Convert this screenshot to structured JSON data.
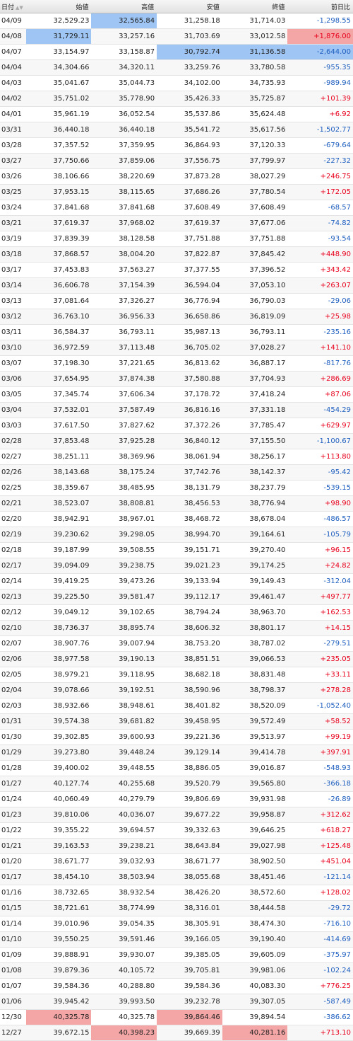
{
  "headers": {
    "date": "日付",
    "open": "始値",
    "high": "高値",
    "low": "安値",
    "close": "終値",
    "change": "前日比"
  },
  "sort_icons": {
    "up": "▲",
    "down": "▼"
  },
  "colors": {
    "positive": "#e8001c",
    "negative": "#1f5fc0",
    "highlight_blue": "#9ec5f3",
    "highlight_red": "#f4a6a6"
  },
  "rows": [
    {
      "date": "04/09",
      "open": "32,529.23",
      "high": "32,565.84",
      "low": "31,258.18",
      "close": "31,714.03",
      "change": "-1,298.55"
    },
    {
      "date": "04/08",
      "open": "31,729.11",
      "high": "33,257.16",
      "low": "31,703.69",
      "close": "33,012.58",
      "change": "+1,876.00"
    },
    {
      "date": "04/07",
      "open": "33,154.97",
      "high": "33,158.87",
      "low": "30,792.74",
      "close": "31,136.58",
      "change": "-2,644.00"
    },
    {
      "date": "04/04",
      "open": "34,304.66",
      "high": "34,320.11",
      "low": "33,259.76",
      "close": "33,780.58",
      "change": "-955.35"
    },
    {
      "date": "04/03",
      "open": "35,041.67",
      "high": "35,044.73",
      "low": "34,102.00",
      "close": "34,735.93",
      "change": "-989.94"
    },
    {
      "date": "04/02",
      "open": "35,751.02",
      "high": "35,778.90",
      "low": "35,426.33",
      "close": "35,725.87",
      "change": "+101.39"
    },
    {
      "date": "04/01",
      "open": "35,961.19",
      "high": "36,052.54",
      "low": "35,537.86",
      "close": "35,624.48",
      "change": "+6.92"
    },
    {
      "date": "03/31",
      "open": "36,440.18",
      "high": "36,440.18",
      "low": "35,541.72",
      "close": "35,617.56",
      "change": "-1,502.77"
    },
    {
      "date": "03/28",
      "open": "37,357.52",
      "high": "37,359.95",
      "low": "36,864.93",
      "close": "37,120.33",
      "change": "-679.64"
    },
    {
      "date": "03/27",
      "open": "37,750.66",
      "high": "37,859.06",
      "low": "37,556.75",
      "close": "37,799.97",
      "change": "-227.32"
    },
    {
      "date": "03/26",
      "open": "38,106.66",
      "high": "38,220.69",
      "low": "37,873.28",
      "close": "38,027.29",
      "change": "+246.75"
    },
    {
      "date": "03/25",
      "open": "37,953.15",
      "high": "38,115.65",
      "low": "37,686.26",
      "close": "37,780.54",
      "change": "+172.05"
    },
    {
      "date": "03/24",
      "open": "37,841.68",
      "high": "37,841.68",
      "low": "37,608.49",
      "close": "37,608.49",
      "change": "-68.57"
    },
    {
      "date": "03/21",
      "open": "37,619.37",
      "high": "37,968.02",
      "low": "37,619.37",
      "close": "37,677.06",
      "change": "-74.82"
    },
    {
      "date": "03/19",
      "open": "37,839.39",
      "high": "38,128.58",
      "low": "37,751.88",
      "close": "37,751.88",
      "change": "-93.54"
    },
    {
      "date": "03/18",
      "open": "37,868.57",
      "high": "38,004.20",
      "low": "37,822.87",
      "close": "37,845.42",
      "change": "+448.90"
    },
    {
      "date": "03/17",
      "open": "37,453.83",
      "high": "37,563.27",
      "low": "37,377.55",
      "close": "37,396.52",
      "change": "+343.42"
    },
    {
      "date": "03/14",
      "open": "36,606.78",
      "high": "37,154.39",
      "low": "36,594.04",
      "close": "37,053.10",
      "change": "+263.07"
    },
    {
      "date": "03/13",
      "open": "37,081.64",
      "high": "37,326.27",
      "low": "36,776.94",
      "close": "36,790.03",
      "change": "-29.06"
    },
    {
      "date": "03/12",
      "open": "36,763.10",
      "high": "36,956.33",
      "low": "36,658.86",
      "close": "36,819.09",
      "change": "+25.98"
    },
    {
      "date": "03/11",
      "open": "36,584.37",
      "high": "36,793.11",
      "low": "35,987.13",
      "close": "36,793.11",
      "change": "-235.16"
    },
    {
      "date": "03/10",
      "open": "36,972.59",
      "high": "37,113.48",
      "low": "36,705.02",
      "close": "37,028.27",
      "change": "+141.10"
    },
    {
      "date": "03/07",
      "open": "37,198.30",
      "high": "37,221.65",
      "low": "36,813.62",
      "close": "36,887.17",
      "change": "-817.76"
    },
    {
      "date": "03/06",
      "open": "37,654.95",
      "high": "37,874.38",
      "low": "37,580.88",
      "close": "37,704.93",
      "change": "+286.69"
    },
    {
      "date": "03/05",
      "open": "37,345.74",
      "high": "37,606.34",
      "low": "37,178.72",
      "close": "37,418.24",
      "change": "+87.06"
    },
    {
      "date": "03/04",
      "open": "37,532.01",
      "high": "37,587.49",
      "low": "36,816.16",
      "close": "37,331.18",
      "change": "-454.29"
    },
    {
      "date": "03/03",
      "open": "37,617.50",
      "high": "37,827.62",
      "low": "37,372.26",
      "close": "37,785.47",
      "change": "+629.97"
    },
    {
      "date": "02/28",
      "open": "37,853.48",
      "high": "37,925.28",
      "low": "36,840.12",
      "close": "37,155.50",
      "change": "-1,100.67"
    },
    {
      "date": "02/27",
      "open": "38,251.11",
      "high": "38,369.96",
      "low": "38,061.94",
      "close": "38,256.17",
      "change": "+113.80"
    },
    {
      "date": "02/26",
      "open": "38,143.68",
      "high": "38,175.24",
      "low": "37,742.76",
      "close": "38,142.37",
      "change": "-95.42"
    },
    {
      "date": "02/25",
      "open": "38,359.67",
      "high": "38,485.95",
      "low": "38,131.79",
      "close": "38,237.79",
      "change": "-539.15"
    },
    {
      "date": "02/21",
      "open": "38,523.07",
      "high": "38,808.81",
      "low": "38,456.53",
      "close": "38,776.94",
      "change": "+98.90"
    },
    {
      "date": "02/20",
      "open": "38,942.91",
      "high": "38,967.01",
      "low": "38,468.72",
      "close": "38,678.04",
      "change": "-486.57"
    },
    {
      "date": "02/19",
      "open": "39,230.62",
      "high": "39,298.05",
      "low": "38,994.70",
      "close": "39,164.61",
      "change": "-105.79"
    },
    {
      "date": "02/18",
      "open": "39,187.99",
      "high": "39,508.55",
      "low": "39,151.71",
      "close": "39,270.40",
      "change": "+96.15"
    },
    {
      "date": "02/17",
      "open": "39,094.09",
      "high": "39,238.75",
      "low": "39,021.23",
      "close": "39,174.25",
      "change": "+24.82"
    },
    {
      "date": "02/14",
      "open": "39,419.25",
      "high": "39,473.26",
      "low": "39,133.94",
      "close": "39,149.43",
      "change": "-312.04"
    },
    {
      "date": "02/13",
      "open": "39,225.50",
      "high": "39,581.47",
      "low": "39,112.17",
      "close": "39,461.47",
      "change": "+497.77"
    },
    {
      "date": "02/12",
      "open": "39,049.12",
      "high": "39,102.65",
      "low": "38,794.24",
      "close": "38,963.70",
      "change": "+162.53"
    },
    {
      "date": "02/10",
      "open": "38,736.37",
      "high": "38,895.74",
      "low": "38,606.32",
      "close": "38,801.17",
      "change": "+14.15"
    },
    {
      "date": "02/07",
      "open": "38,907.76",
      "high": "39,007.94",
      "low": "38,753.20",
      "close": "38,787.02",
      "change": "-279.51"
    },
    {
      "date": "02/06",
      "open": "38,977.58",
      "high": "39,190.13",
      "low": "38,851.51",
      "close": "39,066.53",
      "change": "+235.05"
    },
    {
      "date": "02/05",
      "open": "38,979.21",
      "high": "39,118.95",
      "low": "38,682.18",
      "close": "38,831.48",
      "change": "+33.11"
    },
    {
      "date": "02/04",
      "open": "39,078.66",
      "high": "39,192.51",
      "low": "38,590.96",
      "close": "38,798.37",
      "change": "+278.28"
    },
    {
      "date": "02/03",
      "open": "38,932.66",
      "high": "38,948.61",
      "low": "38,401.82",
      "close": "38,520.09",
      "change": "-1,052.40"
    },
    {
      "date": "01/31",
      "open": "39,574.38",
      "high": "39,681.82",
      "low": "39,458.95",
      "close": "39,572.49",
      "change": "+58.52"
    },
    {
      "date": "01/30",
      "open": "39,302.85",
      "high": "39,600.93",
      "low": "39,221.36",
      "close": "39,513.97",
      "change": "+99.19"
    },
    {
      "date": "01/29",
      "open": "39,273.80",
      "high": "39,448.24",
      "low": "39,129.14",
      "close": "39,414.78",
      "change": "+397.91"
    },
    {
      "date": "01/28",
      "open": "39,400.02",
      "high": "39,448.55",
      "low": "38,886.05",
      "close": "39,016.87",
      "change": "-548.93"
    },
    {
      "date": "01/27",
      "open": "40,127.74",
      "high": "40,255.68",
      "low": "39,520.79",
      "close": "39,565.80",
      "change": "-366.18"
    },
    {
      "date": "01/24",
      "open": "40,060.49",
      "high": "40,279.79",
      "low": "39,806.69",
      "close": "39,931.98",
      "change": "-26.89"
    },
    {
      "date": "01/23",
      "open": "39,810.06",
      "high": "40,036.07",
      "low": "39,677.22",
      "close": "39,958.87",
      "change": "+312.62"
    },
    {
      "date": "01/22",
      "open": "39,355.22",
      "high": "39,694.57",
      "low": "39,332.63",
      "close": "39,646.25",
      "change": "+618.27"
    },
    {
      "date": "01/21",
      "open": "39,163.53",
      "high": "39,238.21",
      "low": "38,643.84",
      "close": "39,027.98",
      "change": "+125.48"
    },
    {
      "date": "01/20",
      "open": "38,671.77",
      "high": "39,032.93",
      "low": "38,671.77",
      "close": "38,902.50",
      "change": "+451.04"
    },
    {
      "date": "01/17",
      "open": "38,454.10",
      "high": "38,503.94",
      "low": "38,055.68",
      "close": "38,451.46",
      "change": "-121.14"
    },
    {
      "date": "01/16",
      "open": "38,732.65",
      "high": "38,932.54",
      "low": "38,426.20",
      "close": "38,572.60",
      "change": "+128.02"
    },
    {
      "date": "01/15",
      "open": "38,721.61",
      "high": "38,774.99",
      "low": "38,316.01",
      "close": "38,444.58",
      "change": "-29.72"
    },
    {
      "date": "01/14",
      "open": "39,010.96",
      "high": "39,054.35",
      "low": "38,305.91",
      "close": "38,474.30",
      "change": "-716.10"
    },
    {
      "date": "01/10",
      "open": "39,550.25",
      "high": "39,591.46",
      "low": "39,166.05",
      "close": "39,190.40",
      "change": "-414.69"
    },
    {
      "date": "01/09",
      "open": "39,888.91",
      "high": "39,930.07",
      "low": "39,385.05",
      "close": "39,605.09",
      "change": "-375.97"
    },
    {
      "date": "01/08",
      "open": "39,879.36",
      "high": "40,105.72",
      "low": "39,705.81",
      "close": "39,981.06",
      "change": "-102.24"
    },
    {
      "date": "01/07",
      "open": "39,584.36",
      "high": "40,288.80",
      "low": "39,584.36",
      "close": "40,083.30",
      "change": "+776.25"
    },
    {
      "date": "01/06",
      "open": "39,945.42",
      "high": "39,993.50",
      "low": "39,232.78",
      "close": "39,307.05",
      "change": "-587.49"
    },
    {
      "date": "12/30",
      "open": "40,325.78",
      "high": "40,325.78",
      "low": "39,864.46",
      "close": "39,894.54",
      "change": "-386.62"
    },
    {
      "date": "12/27",
      "open": "39,672.15",
      "high": "40,398.23",
      "low": "39,669.39",
      "close": "40,281.16",
      "change": "+713.10"
    }
  ],
  "highlights": [
    {
      "row": 0,
      "col": "high",
      "color": "blue"
    },
    {
      "row": 1,
      "col": "open",
      "color": "blue"
    },
    {
      "row": 1,
      "col": "change",
      "color": "red"
    },
    {
      "row": 2,
      "col": "low",
      "color": "blue"
    },
    {
      "row": 2,
      "col": "close",
      "color": "blue"
    },
    {
      "row": 2,
      "col": "change",
      "color": "blue"
    },
    {
      "row": 64,
      "col": "open",
      "color": "red"
    },
    {
      "row": 64,
      "col": "low",
      "color": "red"
    },
    {
      "row": 65,
      "col": "high",
      "color": "red"
    },
    {
      "row": 65,
      "col": "close",
      "color": "red"
    }
  ]
}
